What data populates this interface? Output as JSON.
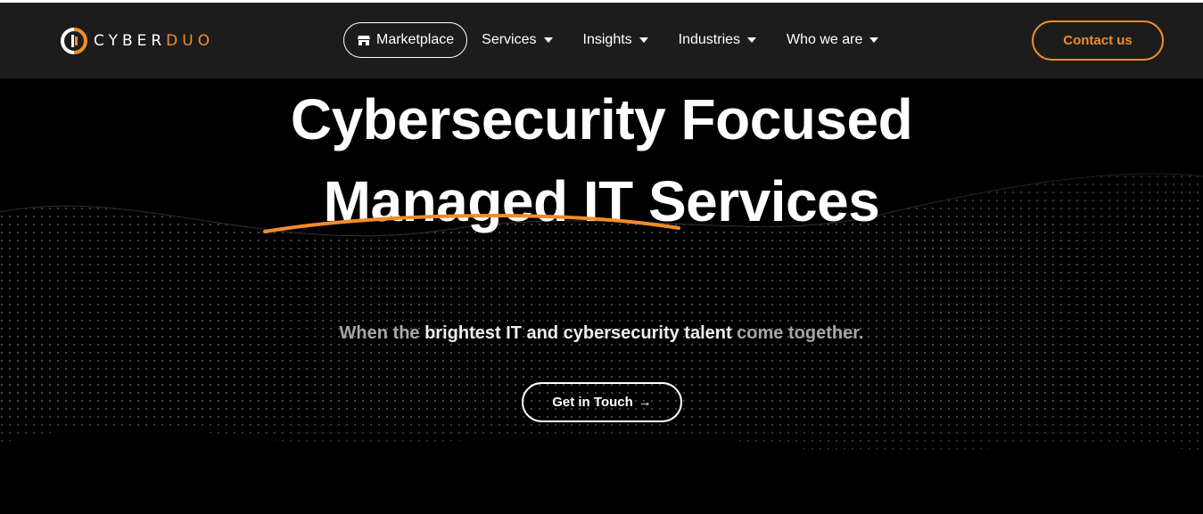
{
  "brand": {
    "logo_text_part1": "CYBER",
    "logo_text_part2": "DUO",
    "accent_color": "#f28c28"
  },
  "nav": {
    "marketplace_label": "Marketplace",
    "marketplace_icon": "store-icon",
    "items": [
      {
        "label": "Services",
        "icon": "chevron-down-icon"
      },
      {
        "label": "Insights",
        "icon": "chevron-down-icon"
      },
      {
        "label": "Industries",
        "icon": "chevron-down-icon"
      },
      {
        "label": "Who we are",
        "icon": "chevron-down-icon"
      }
    ],
    "contact_label": "Contact us"
  },
  "hero": {
    "headline_word_highlight": "Cybersecurity",
    "headline_rest_line1": " Focused",
    "headline_line2": "Managed IT Services",
    "sub_prefix": "When the ",
    "sub_bold": "brightest IT and cybersecurity talent",
    "sub_suffix": " come together.",
    "cta_label": "Get in Touch",
    "cta_icon": "arrow-right-icon"
  }
}
